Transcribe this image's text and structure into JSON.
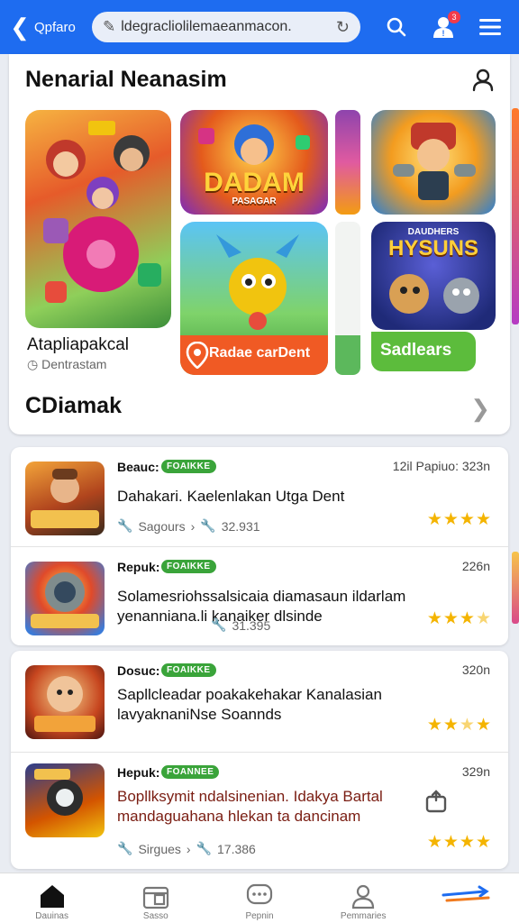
{
  "topbar": {
    "brand": "Qpfaro",
    "url": "ldegracliolilemaeanmacon.",
    "notif_count": "3"
  },
  "featured": {
    "title": "Nenarial Neanasim",
    "tiles": [
      {
        "label": ""
      },
      {
        "label": "DADAM",
        "sub": "PASAGAR"
      },
      {
        "label": ""
      },
      {
        "label": "Radae carDent"
      },
      {
        "label": "HYSUNS",
        "top": "DAUDHERS"
      },
      {
        "label": "Sadlears"
      }
    ],
    "big_caption": "Atapliapakcal",
    "big_sub": "Dentrastam",
    "see_all": "CDiamak"
  },
  "list": [
    {
      "publisher": "Beauc:",
      "badge": "FOAIKKE",
      "meta": "12il Papiuo: 323n",
      "desc": "Dahakari. Kaelenlakan Utga Dent",
      "sub1": "Sagours",
      "sub2": "32.931",
      "rating": 4,
      "thumb_text": "CELKAAL\nPAXY"
    },
    {
      "publisher": "Repuk:",
      "badge": "FOAIKKE",
      "meta": "226n",
      "desc": "Solamesriohssalsicaia diamasaun ildarlam yenanniana.li kanaiker dlsinde",
      "sub1": "",
      "sub2": "31.395",
      "rating": 3.5,
      "thumb_text": "DUNDAVIUS"
    },
    {
      "publisher": "Dosuc:",
      "badge": "FOAIKKE",
      "meta": "320n",
      "desc": "Sapllcleadar poakakehakar Kanalasian lavyaknaniNse Soannds",
      "sub1": "",
      "sub2": "",
      "rating": 3.5,
      "thumb_text": "OMANE"
    },
    {
      "publisher": "Hepuk:",
      "badge": "FOANNEE",
      "meta": "329n",
      "desc": "Bopllksymit ndalsinenian. Idakya Bartal mandaguahana hlekan ta dancinam",
      "sub1": "Sirgues",
      "sub2": "17.386",
      "rating": 4,
      "thumb_text": "DANE"
    }
  ],
  "bottom_nav": [
    {
      "label": "Dauinas"
    },
    {
      "label": "Sasso"
    },
    {
      "label": "Pepnin"
    },
    {
      "label": "Pemmaries"
    },
    {
      "label": ""
    }
  ],
  "colors": {
    "topbar": "#1e6cf0",
    "badge": "#3aa43a",
    "star": "#f4b400"
  }
}
